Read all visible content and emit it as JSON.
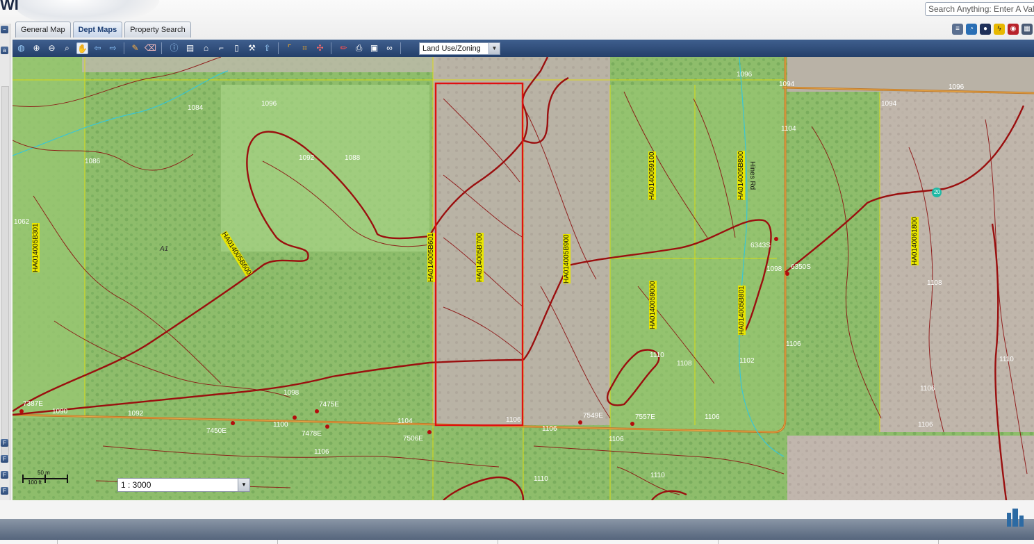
{
  "app": {
    "logo_text": "WI"
  },
  "search": {
    "placeholder": "Search Anything: Enter A Value"
  },
  "tabs": [
    {
      "label": "General Map"
    },
    {
      "label": "Dept Maps"
    },
    {
      "label": "Property Search"
    }
  ],
  "toolbar": {
    "tools": [
      "zoom-full-icon",
      "zoom-in-icon",
      "zoom-out-icon",
      "zoom-box-icon",
      "pan-icon",
      "back-icon",
      "forward-icon",
      "paint-icon",
      "eraser-icon",
      "identify-icon",
      "layers-icon",
      "select-icon",
      "measure-icon",
      "document-icon",
      "hammer-icon",
      "up-arrow-icon",
      "crop-corner-icon",
      "crop-icon",
      "xy-point-icon",
      "pencil-icon",
      "print-icon",
      "export-icon",
      "link-icon"
    ],
    "layer_select": "Land Use/Zoning"
  },
  "map": {
    "scale": "1 : 3000",
    "scalebar_m": "50 m",
    "scalebar_ft": "100 ft",
    "zoning_code": "A1",
    "road_name": "Hines Rd",
    "road_shield": "20",
    "parcels": [
      "HA014005B301",
      "HA014005B600",
      "HA014005B601",
      "HA014005B700",
      "HA014005B900",
      "HA014005910​0",
      "HA014005B800",
      "HA0140059000",
      "HA014005B801",
      "HA014006180​0"
    ],
    "addresses": [
      "7387E",
      "7475E",
      "7450E",
      "7478E",
      "7506E",
      "7549E",
      "7557E",
      "6343S",
      "6350S"
    ],
    "contours": [
      "1090",
      "1092",
      "1100",
      "1104",
      "1106",
      "1106",
      "1106",
      "1106",
      "1106",
      "1110",
      "1110",
      "1098",
      "1096",
      "1086",
      "1084",
      "1096",
      "1088",
      "1092",
      "1092",
      "1094",
      "1096",
      "1092",
      "1094",
      "1104",
      "1098",
      "1102",
      "1108",
      "1108",
      "1106",
      "1110",
      "1106",
      "1062",
      "1106",
      "1110"
    ]
  },
  "colors": {
    "toolbar": "#2f4e7c",
    "parcel_highlight": "#e01010",
    "contour": "#8b0f0f"
  }
}
